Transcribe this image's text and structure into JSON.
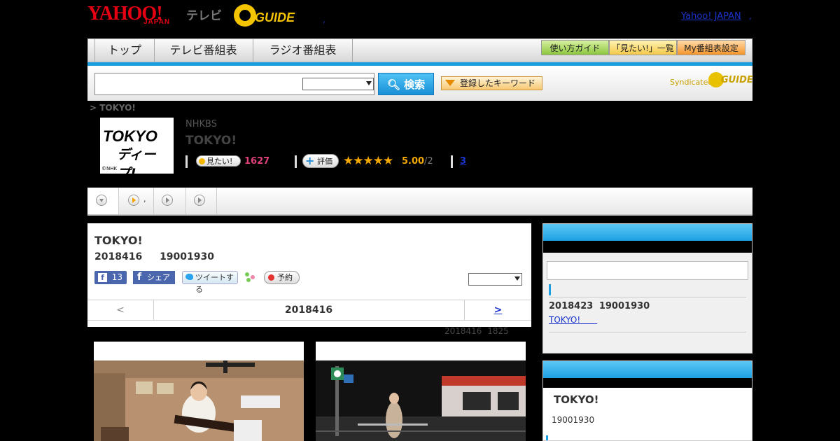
{
  "header": {
    "logo_yahoo": "YAHOO!",
    "logo_japan": "JAPAN",
    "logo_tv": "テレビ",
    "logo_gguide": "GUIDE",
    "dot": ",",
    "yahoo_japan_link": "Yahoo! JAPAN",
    "link_suffix": ","
  },
  "nav": {
    "tabs": [
      "トップ",
      "テレビ番組表",
      "ラジオ番組表"
    ],
    "guide_buttons": [
      "使い方ガイド",
      "「見たい!」一覧",
      "My番組表設定"
    ]
  },
  "search": {
    "input_value": "",
    "select_value": "",
    "button_label": "検索",
    "keyword_button": "登録したキーワード",
    "syndicated": "Syndicated",
    "syndicated_brand": "GUIDE"
  },
  "program": {
    "breadcrumb": "> TOKYO!",
    "thumb_line1": "TOKYO",
    "thumb_line2": "ディープ!",
    "thumb_credit": "©NHK",
    "channel": "NHKBS",
    "title": "TOKYO!",
    "mitai_label": "見たい!",
    "mitai_count": "1627",
    "hyoka_label": "評価",
    "stars": "★★★★★",
    "rating": "5.00",
    "rating_count": "/2",
    "review_link": "3"
  },
  "tabs": {
    "tab2_text": ","
  },
  "main": {
    "title": "TOKYO!",
    "date_line": "2018416 19001930",
    "fb_like_count": "13",
    "fb_share": "シェア",
    "tweet": "ツイートする",
    "reserve": "予約",
    "select_value": "",
    "prev": "<",
    "date": "2018416",
    "next": ">",
    "updated": "2018416 1825"
  },
  "sidebar": {
    "date": "2018423 19001930",
    "link": "TOKYO!",
    "card2_title": "TOKYO!",
    "card2_time": "19001930"
  },
  "colors": {
    "accent_blue": "#1da0e3",
    "brand_red": "#e60012",
    "gguide_yellow": "#f5c400",
    "mitai_pink": "#e0407a",
    "star_orange": "#f5a800"
  }
}
